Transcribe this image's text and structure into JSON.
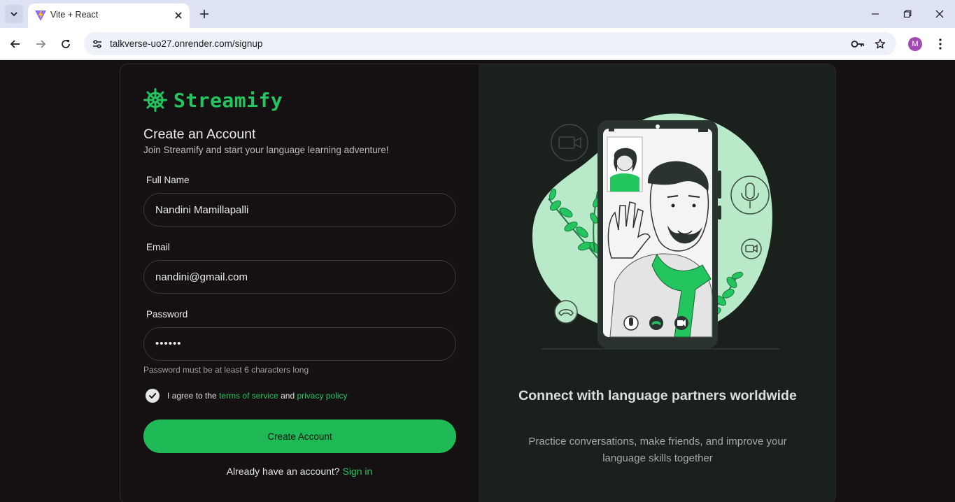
{
  "browser": {
    "tab_title": "Vite + React",
    "url": "talkverse-uo27.onrender.com/signup",
    "profile_initial": "M"
  },
  "brand": {
    "name": "Streamify",
    "accent_color": "#22c55e"
  },
  "form": {
    "heading": "Create an Account",
    "subheading": "Join Streamify and start your language learning adventure!",
    "full_name": {
      "label": "Full Name",
      "value": "Nandini Mamillapalli"
    },
    "email": {
      "label": "Email",
      "value": "nandini@gmail.com"
    },
    "password": {
      "label": "Password",
      "value": "••••••",
      "hint": "Password must be at least 6 characters long"
    },
    "agree": {
      "checked": true,
      "prefix": "I agree to the",
      "terms": "terms of service",
      "and": "and",
      "privacy": "privacy policy"
    },
    "submit_label": "Create Account",
    "signin_prompt": "Already have an account?",
    "signin_link": "Sign in"
  },
  "promo": {
    "title": "Connect with language partners worldwide",
    "text": "Practice conversations, make friends, and improve your language skills together"
  }
}
